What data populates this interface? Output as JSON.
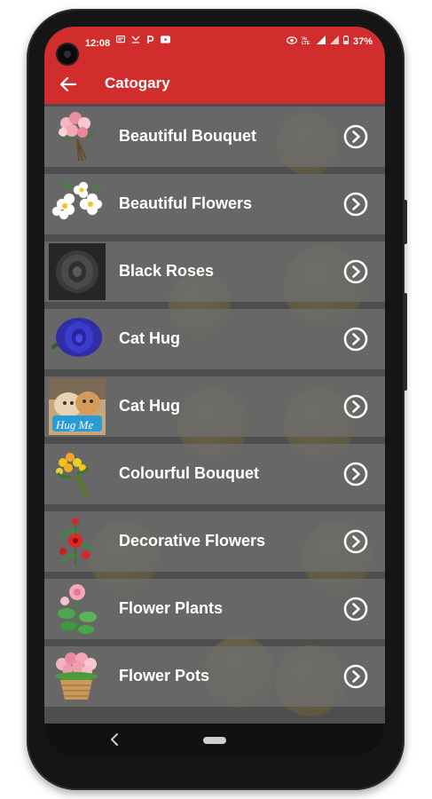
{
  "status_bar": {
    "time": "12:08",
    "battery": "37%",
    "left_icons": [
      "message-icon",
      "missed-call-icon",
      "paytm-icon",
      "youtube-icon"
    ],
    "right_icons": [
      "eye-icon",
      "volte-icon",
      "signal-icon",
      "signal-icon",
      "battery-icon"
    ]
  },
  "app_bar": {
    "title": "Catogary",
    "back_icon": "arrow-left-icon",
    "color": "#d12d2d"
  },
  "categories": [
    {
      "label": "Beautiful Bouquet",
      "icon": "bouquet-icon"
    },
    {
      "label": "Beautiful Flowers",
      "icon": "flowers-icon"
    },
    {
      "label": "Black Roses",
      "icon": "black-rose-icon"
    },
    {
      "label": "Cat Hug",
      "icon": "blue-rose-icon"
    },
    {
      "label": "Cat Hug",
      "icon": "cat-hug-icon",
      "badge": "Hug Me"
    },
    {
      "label": "Colourful Bouquet",
      "icon": "bouquet-icon"
    },
    {
      "label": "Decorative Flowers",
      "icon": "red-flowers-icon"
    },
    {
      "label": "Flower Plants",
      "icon": "flower-plant-icon"
    },
    {
      "label": "Flower Pots",
      "icon": "flower-pot-icon"
    }
  ],
  "row_action_icon": "chevron-right-circle-icon",
  "nav_bar": {
    "back_icon": "nav-back-icon",
    "home_icon": "nav-home-pill-icon"
  }
}
